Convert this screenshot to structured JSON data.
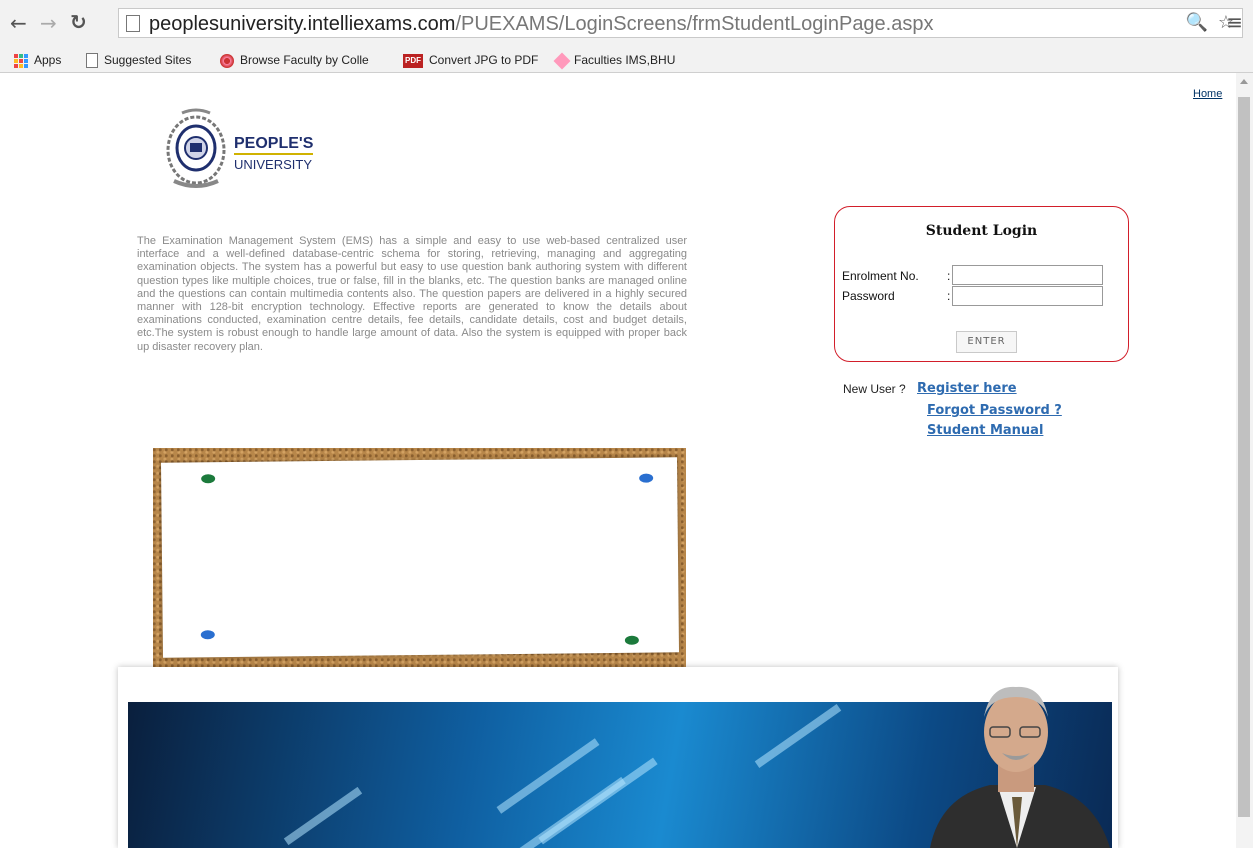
{
  "browser": {
    "url_host": "peoplesuniversity.intelliexams.com",
    "url_path": "/PUEXAMS/LoginScreens/frmStudentLoginPage.aspx",
    "bookmarks": [
      "Apps",
      "Suggested Sites",
      "Browse Faculty by Colle",
      "Convert JPG to PDF",
      "Faculties IMS,BHU"
    ]
  },
  "page": {
    "home_link": "Home",
    "logo": {
      "line1": "PEOPLE'S",
      "line2": "UNIVERSITY"
    },
    "description": "The Examination Management System (EMS) has a simple and easy to use web-based centralized user interface and a well-defined database-centric schema for storing, retrieving, managing and aggregating examination objects. The system has a powerful but easy to use question bank authoring system with different question types like multiple choices, true or false, fill in the blanks, etc. The question banks are managed online and the questions can contain multimedia contents also. The question papers are delivered in a highly secured manner with 128-bit encryption technology. Effective reports are generated to know the details about examinations conducted, examination centre details, fee details, candidate details, cost and budget details, etc.The system is robust enough to handle large amount of data. Also the system is equipped with proper back up disaster recovery plan."
  },
  "login": {
    "title": "Student Login",
    "enrolment_label": "Enrolment No.",
    "password_label": "Password",
    "colon": ":",
    "enrolment_value": "",
    "password_value": "",
    "enter_label": "ENTER"
  },
  "links": {
    "new_user": "New User ?",
    "register": "Register here",
    "forgot": "Forgot Password ?",
    "manual": "Student Manual"
  },
  "colors": {
    "login_border": "#d21e2a",
    "link": "#2e6bb0"
  }
}
